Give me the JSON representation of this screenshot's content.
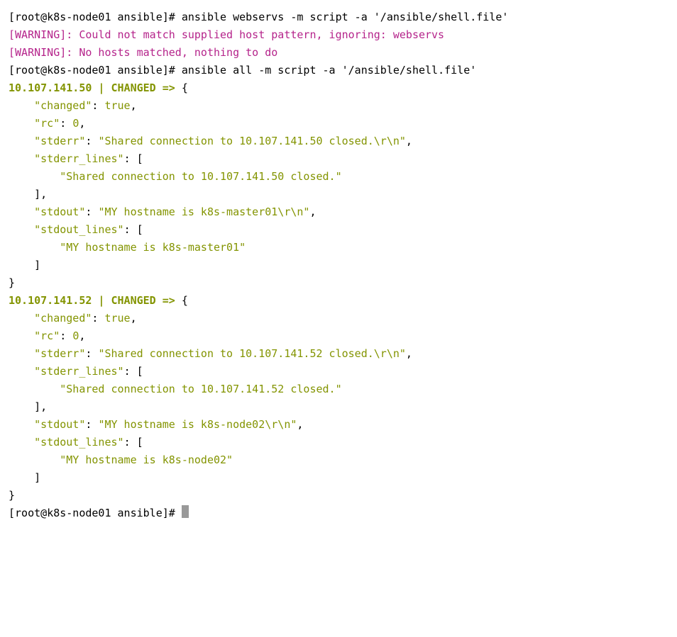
{
  "lines": {
    "0": {
      "prompt_prefix": "[root@",
      "hostname": "k8s-node01",
      "dir": " ansible",
      "hash": "]# ",
      "command": "ansible webservs -m script -a '/ansible/shell.file'"
    },
    "1": {
      "text": "[WARNING]: Could not match supplied host pattern, ignoring: webservs"
    },
    "2": {
      "text": "[WARNING]: No hosts matched, nothing to do"
    },
    "3": {
      "prompt_prefix": "[root@",
      "hostname": "k8s-node01",
      "dir": " ansible",
      "hash": "]# ",
      "command": "ansible all -m script -a '/ansible/shell.file'"
    },
    "4": {
      "prompt_prefix": "[root@",
      "hostname": "k8s-node01",
      "dir": " ansible",
      "hash": "]# "
    }
  },
  "host1": {
    "ip": "10.107.141.50",
    "sep": " | ",
    "status": "CHANGED",
    "arrow": " => ",
    "brace_open": "{",
    "changed_key": "    \"changed\"",
    "colon": ": ",
    "changed_val": "true",
    "comma": ",",
    "rc_key": "    \"rc\"",
    "rc_val": "0",
    "stderr_key": "    \"stderr\"",
    "stderr_val": "\"Shared connection to 10.107.141.50 closed.\\r\\n\"",
    "stderr_lines_key": "    \"stderr_lines\"",
    "colon_bracket": ": [",
    "stderr_lines_val": "        \"Shared connection to 10.107.141.50 closed.\"",
    "close_bracket": "    ],",
    "stdout_key": "    \"stdout\"",
    "stdout_val": "\"MY hostname is k8s-master01\\r\\n\"",
    "stdout_lines_key": "    \"stdout_lines\"",
    "stdout_lines_val": "        \"MY hostname is k8s-master01\"",
    "close_bracket2": "    ]",
    "brace_close": "}"
  },
  "host2": {
    "ip": "10.107.141.52",
    "sep": " | ",
    "status": "CHANGED",
    "arrow": " => ",
    "brace_open": "{",
    "changed_key": "    \"changed\"",
    "colon": ": ",
    "changed_val": "true",
    "comma": ",",
    "rc_key": "    \"rc\"",
    "rc_val": "0",
    "stderr_key": "    \"stderr\"",
    "stderr_val": "\"Shared connection to 10.107.141.52 closed.\\r\\n\"",
    "stderr_lines_key": "    \"stderr_lines\"",
    "colon_bracket": ": [",
    "stderr_lines_val": "        \"Shared connection to 10.107.141.52 closed.\"",
    "close_bracket": "    ],",
    "stdout_key": "    \"stdout\"",
    "stdout_val": "\"MY hostname is k8s-node02\\r\\n\"",
    "stdout_lines_key": "    \"stdout_lines\"",
    "stdout_lines_val": "        \"MY hostname is k8s-node02\"",
    "close_bracket2": "    ]",
    "brace_close": "}"
  }
}
